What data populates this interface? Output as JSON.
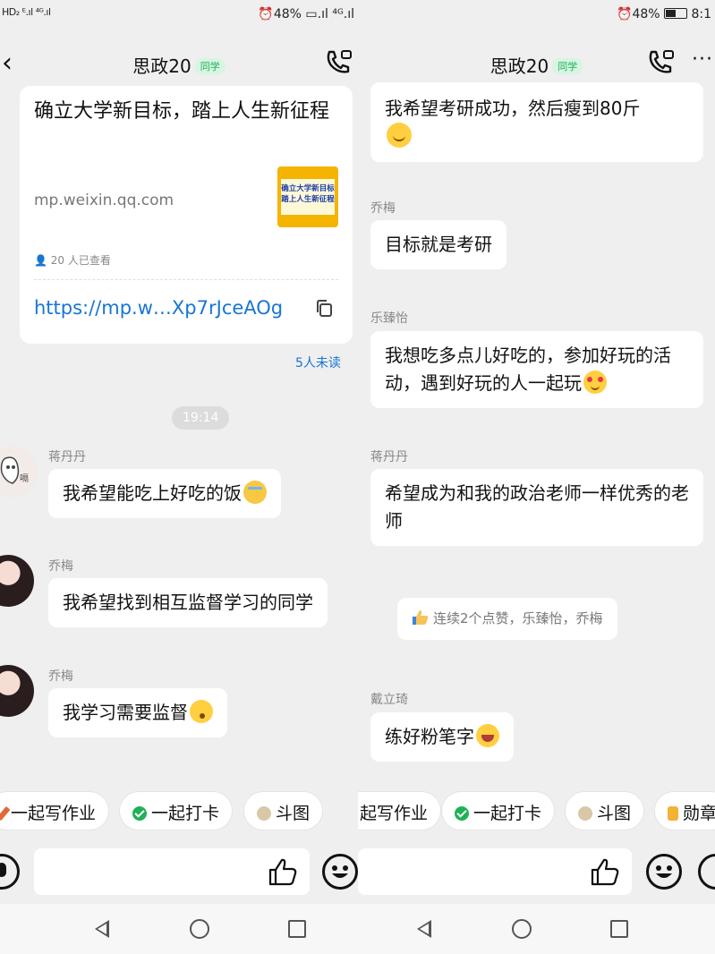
{
  "left": {
    "statusbar": {
      "left_text": "HD₂ ᴱ.ıl ⁴ᴳ.ıl",
      "right_text": "⏰48% ▭.ıl ⁴ᴳ.ıl"
    },
    "header": {
      "title": "思政20",
      "badge": "同学"
    },
    "link_card": {
      "title": "确立大学新目标，踏上人生新征程",
      "domain": "mp.weixin.qq.com",
      "thumb_text": "确立大学新目标\n踏上人生新征程",
      "views": "20 人已查看",
      "url": "https://mp.w…Xp7rJceAOg"
    },
    "unread": "5人未读",
    "time": "19:14",
    "messages": [
      {
        "sender": "蒋丹丹",
        "text": "我希望能吃上好吃的饭"
      },
      {
        "sender": "乔梅",
        "text": "我希望找到相互监督学习的同学"
      },
      {
        "sender": "乔梅",
        "text": "我学习需要监督"
      }
    ],
    "quick_actions": [
      "一起写作业",
      "一起打卡",
      "斗图"
    ]
  },
  "right": {
    "statusbar": {
      "right_text": "⏰48% ",
      "clock": "8:1"
    },
    "header": {
      "title": "思政20",
      "badge": "同学"
    },
    "messages": [
      {
        "sender": "",
        "text": "我希望考研成功，然后瘦到80斤"
      },
      {
        "sender": "乔梅",
        "text": "目标就是考研"
      },
      {
        "sender": "乐臻怡",
        "text": "我想吃多点儿好吃的，参加好玩的活动，遇到好玩的人一起玩"
      },
      {
        "sender": "蒋丹丹",
        "text": "希望成为和我的政治老师一样优秀的老师"
      },
      {
        "sender": "戴立琦",
        "text": "练好粉笔字"
      }
    ],
    "like_notice": "连续2个点赞，乐臻怡，乔梅",
    "quick_actions": [
      "起写作业",
      "一起打卡",
      "斗图",
      "勋章"
    ]
  },
  "icons": {
    "back": "back-arrow-icon",
    "call": "phone-call-icon",
    "copy": "copy-icon",
    "thumbs_up": "thumbs-up-icon",
    "emoji": "emoji-icon",
    "voice": "voice-icon"
  },
  "colors": {
    "link": "#1775d6",
    "badge": "#1eb157",
    "background": "#efefef"
  }
}
